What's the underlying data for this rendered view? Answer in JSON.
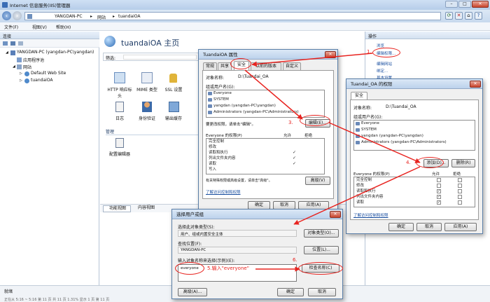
{
  "window": {
    "title": "Internet 信息服务(IIS)管理器",
    "breadcrumb": [
      "YANGDAN-PC",
      "网站",
      "tuandaiOA"
    ],
    "menu": [
      "文件(F)",
      "视图(V)",
      "帮助(H)"
    ],
    "status": "就绪",
    "statusbar": "正在从 5:16 ~ 5:16  第 11 页  共 11 页  1.31% 显示 1 页  第 11 页"
  },
  "connections": {
    "header": "连接",
    "tree": [
      "YANGDAN-PC (yangdan-PC\\yangdan)",
      "应用程序池",
      "网站",
      "Default Web Site",
      "tuandaiOA"
    ]
  },
  "main": {
    "title": "tuandaiOA 主页",
    "filter_label": "筛选:",
    "icons": [
      "HTTP 响应标头",
      "MIME 类型",
      "SSL 设置",
      "日志",
      "身份验证",
      "输出缓存"
    ],
    "group": "管理",
    "config_editor": "配置编辑器",
    "views": [
      "功能视图",
      "内容视图"
    ]
  },
  "actions": {
    "header": "操作",
    "items": [
      "浏览",
      "编辑权限...",
      "编辑网站",
      "绑定...",
      "基本设置..."
    ]
  },
  "props_dialog": {
    "title": "TuandaiOA 属性",
    "tabs": [
      "常规",
      "共享",
      "安全",
      "以前的版本",
      "自定义"
    ],
    "object_label": "对象名称:",
    "object_value": "D:\\Tuandai_OA",
    "group_label": "组或用户名(G):",
    "users": [
      "Everyone",
      "SYSTEM",
      "yangdan (yangdan-PC\\yangdan)",
      "Administrators (yangdan-PC\\Administrators)"
    ],
    "edit_hint": "要更改权限，请单击\"编辑\"。",
    "edit_btn": "编辑(E)...",
    "perm_header": "Everyone 的权限(P)",
    "allow": "允许",
    "deny": "拒绝",
    "perms": [
      "完全控制",
      "修改",
      "读取和执行",
      "列出文件夹内容",
      "读取",
      "写入"
    ],
    "perm_checks": [
      false,
      false,
      true,
      true,
      true,
      false
    ],
    "adv_hint": "有关特殊权限或高级设置，请单击\"高级\"。",
    "adv_btn": "高级(V)",
    "learn": "了解访问控制和权限",
    "ok": "确定",
    "cancel": "取消",
    "apply": "应用(A)"
  },
  "perm_dialog": {
    "title": "Tuandai_OA 的权限",
    "tab": "安全",
    "object_label": "对象名称:",
    "object_value": "D:\\Tuandai_OA",
    "group_label": "组或用户名(G):",
    "users": [
      "Everyone",
      "SYSTEM",
      "yangdan (yangdan-PC\\yangdan)",
      "Administrators (yangdan-PC\\Administrators)"
    ],
    "add_btn": "添加(D)...",
    "remove_btn": "删除(R)",
    "perm_header": "Everyone 的权限(P)",
    "allow": "允许",
    "deny": "拒绝",
    "perms": [
      "完全控制",
      "修改",
      "读取和执行",
      "列出文件夹内容",
      "读取"
    ],
    "learn": "了解访问控制和权限",
    "ok": "确定",
    "cancel": "取消",
    "apply": "应用(A)"
  },
  "select_dialog": {
    "title": "选择用户或组",
    "type_label": "选择此对象类型(S):",
    "type_value": "用户、组或内置安全主体",
    "type_btn": "对象类型(O)...",
    "loc_label": "查找位置(F):",
    "loc_value": "YANGDAN-PC",
    "loc_btn": "位置(L)...",
    "name_label": "输入对象名称来选择(示例)(E):",
    "name_value": "everyone",
    "check_btn": "检查名称(C)",
    "adv_btn": "高级(A)...",
    "ok": "确定",
    "cancel": "取消"
  },
  "annotations": {
    "step1": "1.",
    "step3": "3.",
    "step4": "4.",
    "step5": "5.输入\"everyone\"",
    "step6": "6."
  },
  "colors": {
    "annotation": "#e8231f",
    "titlebar": "#cfe0f4"
  }
}
